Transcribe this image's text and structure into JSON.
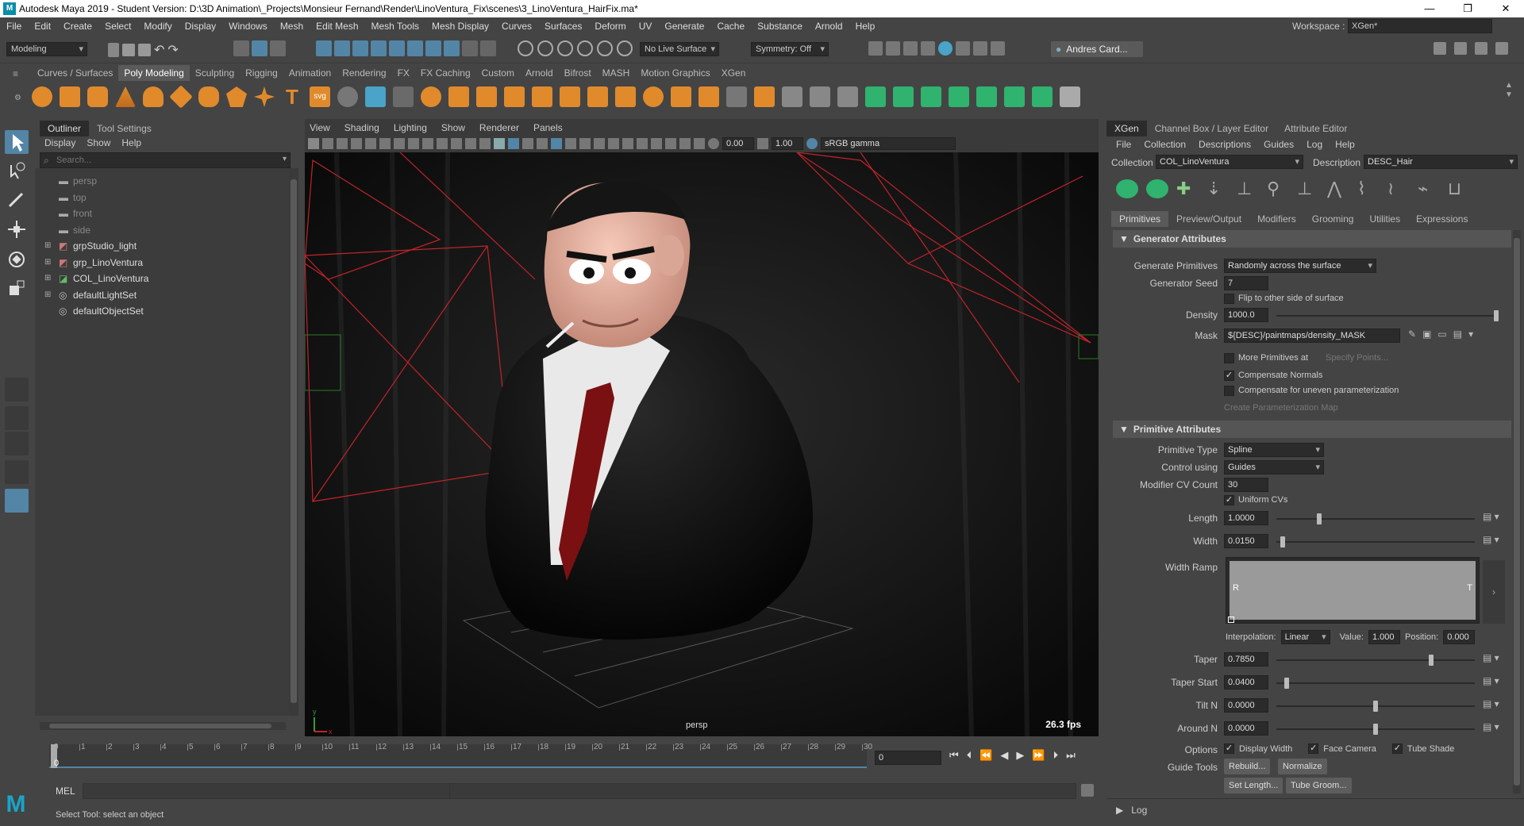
{
  "window": {
    "title": "Autodesk Maya 2019 - Student Version: D:\\3D Animation\\_Projects\\Monsieur Fernand\\Render\\LinoVentura_Fix\\scenes\\3_LinoVentura_HairFix.ma*",
    "logo": "M",
    "minimize": "—",
    "restore": "❐",
    "close": "✕"
  },
  "menubar": [
    "File",
    "Edit",
    "Create",
    "Select",
    "Modify",
    "Display",
    "Windows",
    "Mesh",
    "Edit Mesh",
    "Mesh Tools",
    "Mesh Display",
    "Curves",
    "Surfaces",
    "Deform",
    "UV",
    "Generate",
    "Cache",
    "Substance",
    "Arnold",
    "Help"
  ],
  "workspace": {
    "label": "Workspace :",
    "value": "XGen*"
  },
  "statusline": {
    "mode": "Modeling",
    "live_surface": "No Live Surface",
    "symmetry": "Symmetry: Off",
    "user": "Andres Card..."
  },
  "shelf_tabs": [
    "Curves / Surfaces",
    "Poly Modeling",
    "Sculpting",
    "Rigging",
    "Animation",
    "Rendering",
    "FX",
    "FX Caching",
    "Custom",
    "Arnold",
    "Bifrost",
    "MASH",
    "Motion Graphics",
    "XGen"
  ],
  "shelf_active": "Poly Modeling",
  "shelf_text_icons": {
    "text_tool": "T",
    "svg_tool": "svg"
  },
  "outliner": {
    "tabs": [
      "Outliner",
      "Tool Settings"
    ],
    "menus": [
      "Display",
      "Show",
      "Help"
    ],
    "search_placeholder": "Search...",
    "items": [
      {
        "label": "persp",
        "icon": "camera-icon",
        "dim": true,
        "expand": false
      },
      {
        "label": "top",
        "icon": "camera-icon",
        "dim": true,
        "expand": false
      },
      {
        "label": "front",
        "icon": "camera-icon",
        "dim": true,
        "expand": false
      },
      {
        "label": "side",
        "icon": "camera-icon",
        "dim": true,
        "expand": false
      },
      {
        "label": "grpStudio_light",
        "icon": "group-icon",
        "dim": false,
        "expand": true
      },
      {
        "label": "grp_LinoVentura",
        "icon": "group-icon",
        "dim": false,
        "expand": true
      },
      {
        "label": "COL_LinoVentura",
        "icon": "xgen-collection-icon",
        "dim": false,
        "expand": true
      },
      {
        "label": "defaultLightSet",
        "icon": "set-icon",
        "dim": false,
        "expand": true
      },
      {
        "label": "defaultObjectSet",
        "icon": "set-icon",
        "dim": false,
        "expand": false
      }
    ]
  },
  "viewport": {
    "menus": [
      "View",
      "Shading",
      "Lighting",
      "Show",
      "Renderer",
      "Panels"
    ],
    "exposure": "0.00",
    "gamma": "1.00",
    "color_space": "sRGB gamma",
    "camera_label": "persp",
    "fps": "26.3 fps",
    "axis_x": "x",
    "axis_y": "y"
  },
  "timeline": {
    "ticks": [
      "0",
      "1",
      "2",
      "3",
      "4",
      "5",
      "6",
      "7",
      "8",
      "9",
      "10",
      "11",
      "12",
      "13",
      "14",
      "15",
      "16",
      "17",
      "18",
      "19",
      "20",
      "21",
      "22",
      "23",
      "24",
      "25",
      "26",
      "27",
      "28",
      "29",
      "30"
    ],
    "current_frame": "0",
    "start_frame_field": "0"
  },
  "command_line": {
    "label": "MEL"
  },
  "help_line": "Select Tool: select an object",
  "xgen": {
    "tabs": [
      "XGen",
      "Channel Box / Layer Editor",
      "Attribute Editor"
    ],
    "menus": [
      "File",
      "Collection",
      "Descriptions",
      "Guides",
      "Log",
      "Help"
    ],
    "collection_label": "Collection",
    "collection": "COL_LinoVentura",
    "description_label": "Description",
    "description": "DESC_Hair",
    "subtabs": [
      "Primitives",
      "Preview/Output",
      "Modifiers",
      "Grooming",
      "Utilities",
      "Expressions"
    ],
    "generator": {
      "title": "Generator Attributes",
      "generate_primitives_label": "Generate Primitives",
      "generate_primitives": "Randomly across the surface",
      "seed_label": "Generator Seed",
      "seed": "7",
      "flip_label": "Flip to other side of surface",
      "density_label": "Density",
      "density": "1000.0",
      "mask_label": "Mask",
      "mask": "${DESC}/paintmaps/density_MASK",
      "more_primitives_label": "More Primitives at",
      "specify_points": "Specify Points...",
      "compensate_normals_label": "Compensate Normals",
      "compensate_uneven_label": "Compensate for uneven parameterization",
      "create_param_map": "Create Parameterization Map"
    },
    "primitive": {
      "title": "Primitive Attributes",
      "type_label": "Primitive Type",
      "type": "Spline",
      "control_label": "Control using",
      "control": "Guides",
      "cv_count_label": "Modifier CV Count",
      "cv_count": "30",
      "uniform_cvs_label": "Uniform CVs",
      "length_label": "Length",
      "length": "1.0000",
      "width_label": "Width",
      "width": "0.0150",
      "width_ramp_label": "Width Ramp",
      "ramp_left": "R",
      "ramp_right": "T",
      "interp_label": "Interpolation:",
      "interp": "Linear",
      "value_label": "Value:",
      "value": "1.000",
      "position_label": "Position:",
      "position": "0.000",
      "taper_label": "Taper",
      "taper": "0.7850",
      "taper_start_label": "Taper Start",
      "taper_start": "0.0400",
      "tilt_label": "Tilt N",
      "tilt": "0.0000",
      "around_label": "Around N",
      "around": "0.0000",
      "options_label": "Options",
      "display_width_label": "Display Width",
      "face_camera_label": "Face Camera",
      "tube_shade_label": "Tube Shade",
      "guide_tools_label": "Guide Tools",
      "rebuild": "Rebuild...",
      "normalize": "Normalize",
      "set_length": "Set Length...",
      "tube_groom": "Tube Groom..."
    },
    "log_label": "Log"
  },
  "accent": "#5285a6",
  "levels": {
    "density": 1.0,
    "length": 0.21,
    "width": 0.02,
    "taper": 0.785,
    "taper_start": 0.04,
    "tilt": 0.5,
    "around": 0.5,
    "timeline_playhead": 0.0
  }
}
